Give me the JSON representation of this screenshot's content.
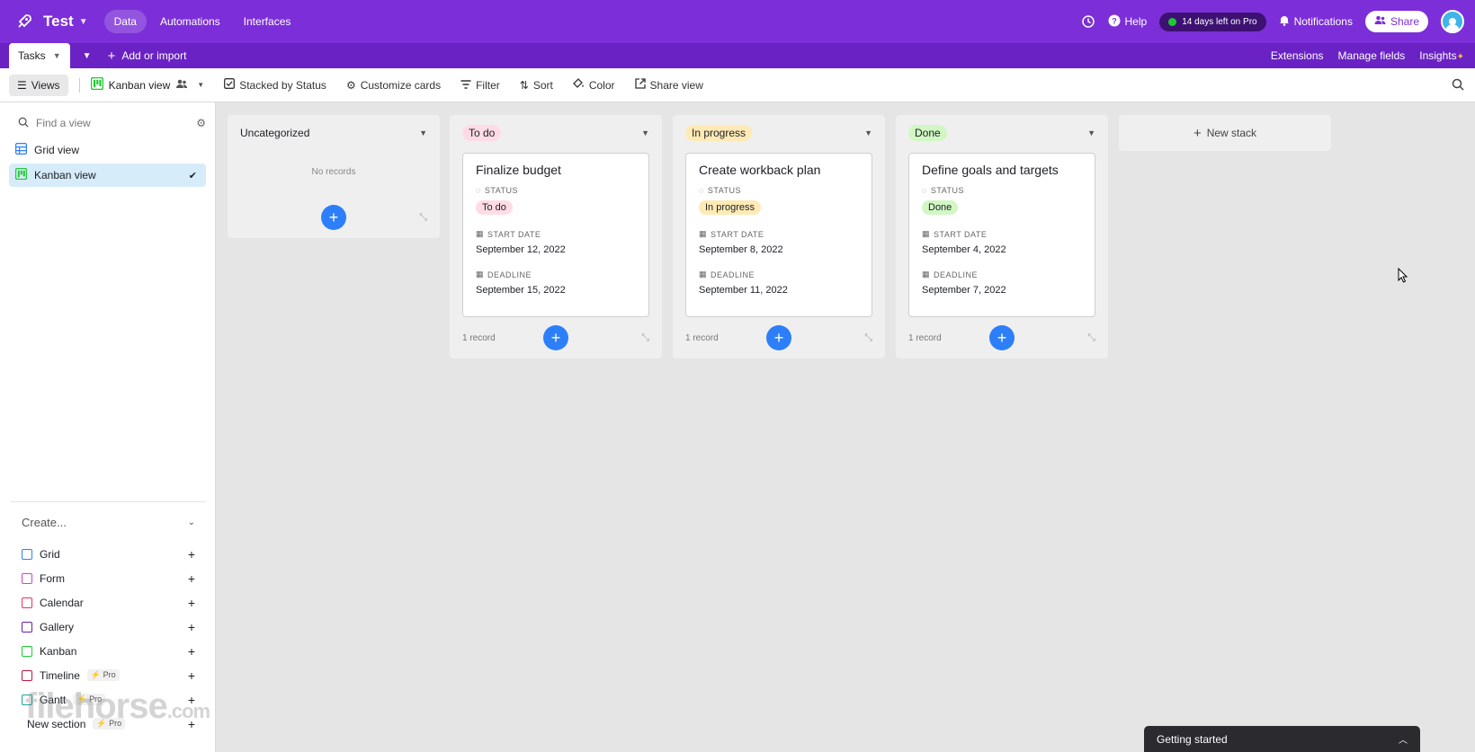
{
  "header": {
    "base_name": "Test",
    "nav": [
      "Data",
      "Automations",
      "Interfaces"
    ],
    "help": "Help",
    "trial": "14 days left on Pro",
    "notifications": "Notifications",
    "share": "Share"
  },
  "tabbar": {
    "table": "Tasks",
    "add_import": "Add or import",
    "right": [
      "Extensions",
      "Manage fields",
      "Insights"
    ]
  },
  "toolbar": {
    "views": "Views",
    "current_view": "Kanban view",
    "stacked": "Stacked by Status",
    "customize": "Customize cards",
    "filter": "Filter",
    "sort": "Sort",
    "color": "Color",
    "share_view": "Share view"
  },
  "sidebar": {
    "find_placeholder": "Find a view",
    "views": [
      "Grid view",
      "Kanban view"
    ],
    "create_label": "Create...",
    "create_items": [
      {
        "label": "Grid",
        "pro": ""
      },
      {
        "label": "Form",
        "pro": ""
      },
      {
        "label": "Calendar",
        "pro": ""
      },
      {
        "label": "Gallery",
        "pro": ""
      },
      {
        "label": "Kanban",
        "pro": ""
      },
      {
        "label": "Timeline",
        "pro": "Pro"
      },
      {
        "label": "Gantt",
        "pro": "Pro"
      },
      {
        "label": "New section",
        "pro": "Pro"
      }
    ],
    "watermark": "filehorse",
    "watermark_tld": ".com"
  },
  "board": {
    "uncategorized": {
      "title": "Uncategorized",
      "empty": "No records"
    },
    "field_labels": {
      "status": "STATUS",
      "start": "START DATE",
      "deadline": "DEADLINE"
    },
    "stacks": [
      {
        "status": "To do",
        "card_title": "Finalize budget",
        "start": "September 12, 2022",
        "deadline": "September 15, 2022",
        "count": "1 record"
      },
      {
        "status": "In progress",
        "card_title": "Create workback plan",
        "start": "September 8, 2022",
        "deadline": "September 11, 2022",
        "count": "1 record"
      },
      {
        "status": "Done",
        "card_title": "Define goals and targets",
        "start": "September 4, 2022",
        "deadline": "September 7, 2022",
        "count": "1 record"
      }
    ],
    "new_stack": "New stack"
  },
  "getting_started": "Getting started",
  "colors": {
    "brand": "#7c2fd8",
    "accent": "#2d7ff9",
    "todo": "#ffdce5",
    "in_progress": "#ffeab6",
    "done": "#d1f7c4"
  }
}
